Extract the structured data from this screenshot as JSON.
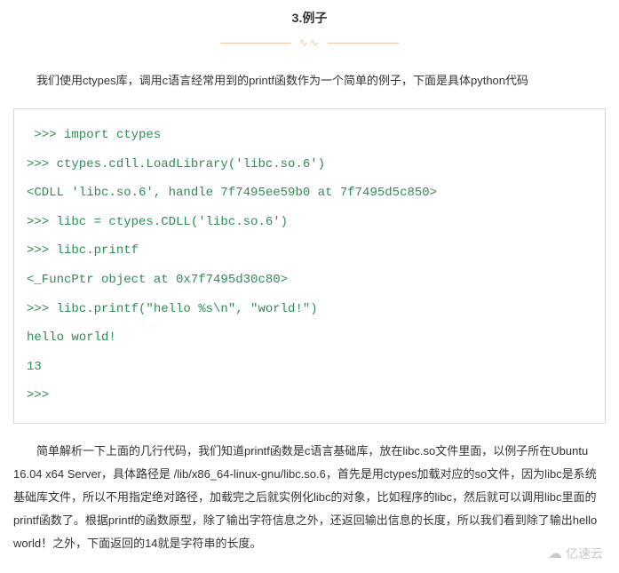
{
  "section": {
    "title": "3.例子"
  },
  "intro_paragraph": "我们使用ctypes库，调用c语言经常用到的printf函数作为一个简单的例子，下面是具体python代码",
  "code": {
    "lines": [
      " >>> import ctypes",
      ">>> ctypes.cdll.LoadLibrary('libc.so.6')",
      "<CDLL 'libc.so.6', handle 7f7495ee59b0 at 7f7495d5c850>",
      ">>> libc = ctypes.CDLL('libc.so.6')",
      ">>> libc.printf",
      "<_FuncPtr object at 0x7f7495d30c80>",
      ">>> libc.printf(\"hello %s\\n\", \"world!\")",
      "hello world!",
      "13",
      ">>>"
    ]
  },
  "explanation_paragraph": "简单解析一下上面的几行代码，我们知道printf函数是c语言基础库，放在libc.so文件里面，以例子所在Ubuntu 16.04 x64 Server，具体路径是 /lib/x86_64-linux-gnu/libc.so.6，首先是用ctypes加载对应的so文件，因为libc是系统基础库文件，所以不用指定绝对路径，加载完之后就实例化libc的对象，比如程序的libc，然后就可以调用libc里面的printf函数了。根据printf的函数原型，除了输出字符信息之外，还返回输出信息的长度，所以我们看到除了输出hello world！之外，下面返回的14就是字符串的长度。",
  "watermark": {
    "text": "亿速云",
    "icon": "☁"
  }
}
